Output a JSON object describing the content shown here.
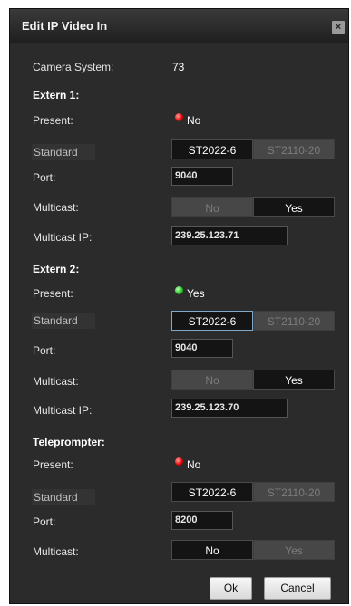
{
  "dialog": {
    "title": "Edit IP Video In",
    "close": "×"
  },
  "camera_system": {
    "label": "Camera System:",
    "value": "73"
  },
  "labels": {
    "present": "Present:",
    "standard": "Standard",
    "port": "Port:",
    "multicast": "Multicast:",
    "multicast_ip": "Multicast IP:"
  },
  "standard_options": [
    "ST2022-6",
    "ST2110-20"
  ],
  "multicast_options": [
    "No",
    "Yes"
  ],
  "extern1": {
    "title": "Extern 1:",
    "present": "No",
    "present_status": "red",
    "standard": "ST2022-6",
    "port": "9040",
    "multicast": "Yes",
    "multicast_ip": "239.25.123.71"
  },
  "extern2": {
    "title": "Extern 2:",
    "present": "Yes",
    "present_status": "green",
    "standard": "ST2022-6",
    "port": "9040",
    "multicast": "Yes",
    "multicast_ip": "239.25.123.70"
  },
  "teleprompter": {
    "title": "Teleprompter:",
    "present": "No",
    "present_status": "red",
    "standard": "ST2022-6",
    "port": "8200",
    "multicast": "No"
  },
  "buttons": {
    "ok": "Ok",
    "cancel": "Cancel"
  },
  "colors": {
    "dialog_bg": "#2b2b2b",
    "selected_bg": "#141414",
    "unselected_bg": "#474747",
    "led_red": "#e00000",
    "led_green": "#1ec01e"
  }
}
